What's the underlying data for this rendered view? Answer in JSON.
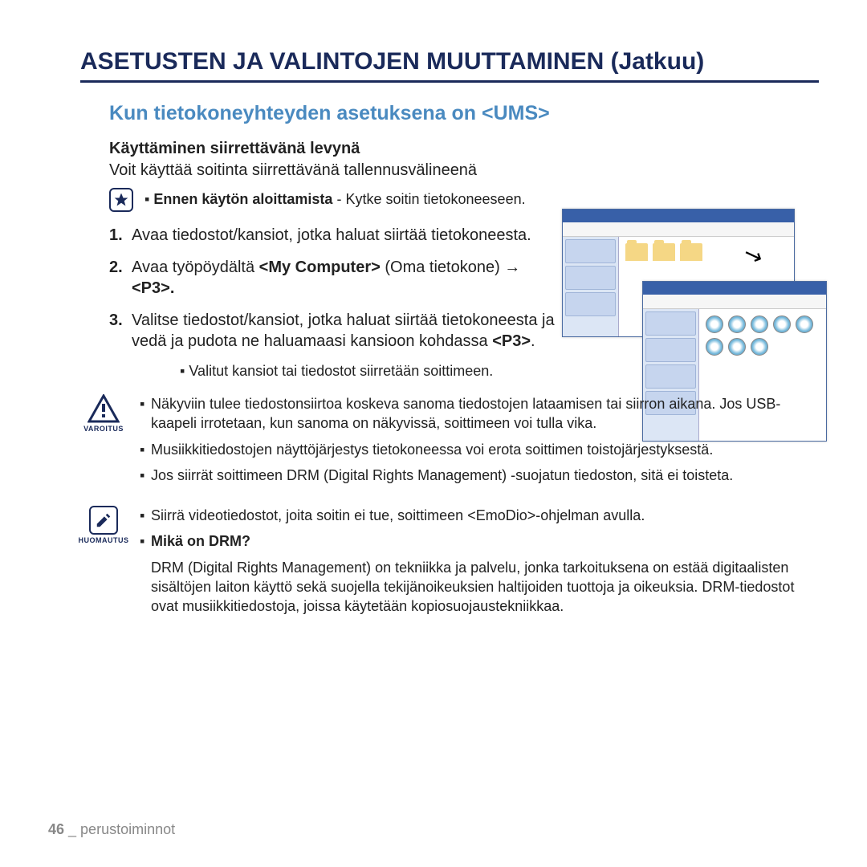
{
  "page_title": "ASETUSTEN JA VALINTOJEN MUUTTAMINEN (Jatkuu)",
  "section_title": "Kun tietokoneyhteyden asetuksena on <UMS>",
  "subheading": "Käyttäminen siirrettävänä levynä",
  "lead_text": "Voit käyttää soitinta siirrettävänä tallennusvälineenä",
  "pre_use": {
    "label": "Ennen käytön aloittamista",
    "text": " - Kytke soitin tietokoneeseen."
  },
  "steps": {
    "s1": "Avaa tiedostot/kansiot, jotka haluat siirtää tietokoneesta.",
    "s2_a": "Avaa työpöydältä ",
    "s2_b": "<My Computer>",
    "s2_c": " (Oma tietokone) → ",
    "s2_d": "<P3>.",
    "s3_a": "Valitse tiedostot/kansiot, jotka haluat siirtää tietokoneesta ja vedä ja pudota ne haluamaasi kansioon kohdassa ",
    "s3_b": "<P3>",
    "s3_c": "."
  },
  "sub_bullet": "Valitut kansiot tai tiedostot siirretään soittimeen.",
  "warning": {
    "label": "VAROITUS",
    "items": [
      "Näkyviin tulee tiedostonsiirtoa koskeva sanoma tiedostojen lataamisen tai siirron aikana. Jos USB-kaapeli irrotetaan, kun sanoma on näkyvissä, soittimeen voi tulla vika.",
      "Musiikkitiedostojen näyttöjärjestys tietokoneessa voi erota soittimen toistojärjestyksestä.",
      "Jos siirrät soittimeen DRM (Digital Rights Management) -suojatun tiedoston, sitä ei toisteta."
    ]
  },
  "note": {
    "label": "HUOMAUTUS",
    "item1": "Siirrä videotiedostot, joita soitin ei tue, soittimeen <EmoDio>-ohjelman avulla.",
    "drm_head": "Mikä on DRM?",
    "drm_body": "DRM (Digital Rights Management) on tekniikka ja palvelu, jonka tarkoituksena on estää digitaalisten sisältöjen laiton käyttö sekä suojella tekijänoikeuksien haltijoiden tuottoja ja oikeuksia. DRM-tiedostot ovat musiikkitiedostoja, joissa käytetään kopiosuojaustekniikkaa."
  },
  "footer": {
    "page_num": "46",
    "sep": " _ ",
    "section": "perustoiminnot"
  }
}
